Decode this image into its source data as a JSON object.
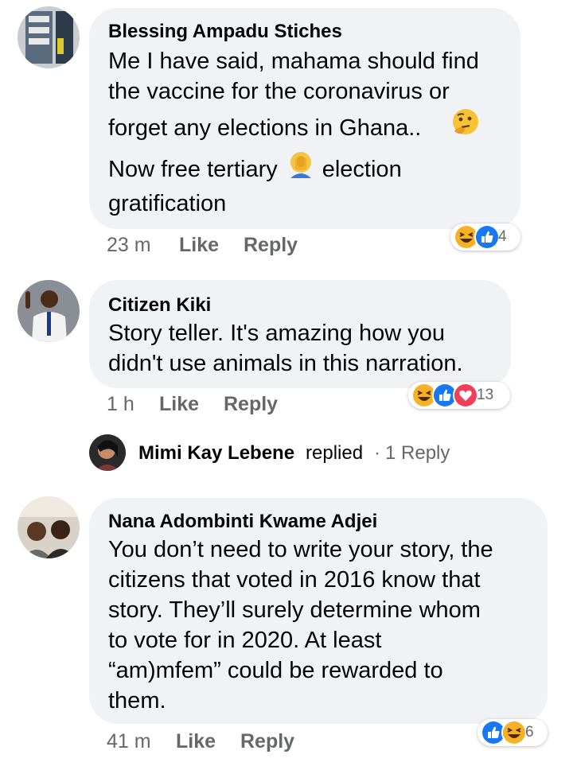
{
  "comments": [
    {
      "author": "Blessing Ampadu Stiches",
      "lines": [
        "Me I have said, mahama should find",
        "the vaccine for the coronavirus or",
        "forget any elections in Ghana..",
        "Now free tertiary",
        "election",
        "gratification"
      ],
      "time": "23 m",
      "like": "Like",
      "reply": "Reply",
      "reaction_count": "4",
      "reactions": [
        "haha-icon",
        "like-icon"
      ]
    },
    {
      "author": "Citizen Kiki",
      "lines": [
        "Story teller. It's amazing how you",
        "didn't use animals in this narration."
      ],
      "time": "1 h",
      "like": "Like",
      "reply": "Reply",
      "reaction_count": "13",
      "reactions": [
        "haha-icon",
        "like-icon",
        "love-icon"
      ]
    },
    {
      "author": "Nana Adombinti Kwame Adjei",
      "lines": [
        "You don’t need to write your story, the",
        "citizens that voted in 2016 know that",
        "story. They’ll surely determine whom",
        "to vote for in 2020. At least",
        "“am)mfem” could be rewarded to",
        "them."
      ],
      "time": "41 m",
      "like": "Like",
      "reply": "Reply",
      "reaction_count": "6",
      "reactions": [
        "like-icon",
        "haha-icon"
      ]
    }
  ],
  "replies_preview": {
    "name": "Mimi Kay Lebene",
    "action": "replied",
    "separator": "·",
    "count_label": "1 Reply"
  },
  "colors": {
    "bubble": "#f0f2f5",
    "meta": "#65676b",
    "like_blue": "#1877f2",
    "love_red": "#f33e58",
    "haha_yellow": "#f7b125"
  }
}
